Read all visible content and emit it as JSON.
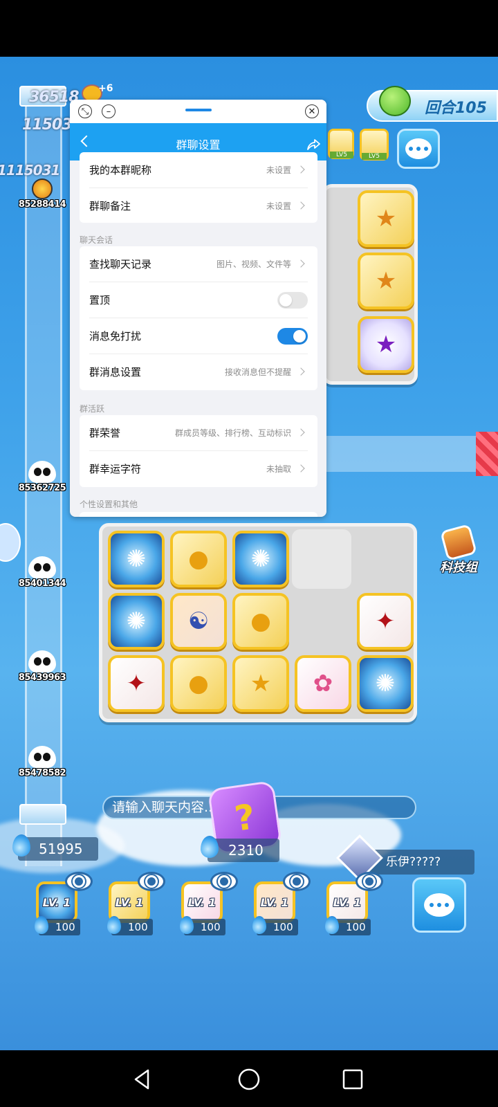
{
  "game": {
    "floating_numbers": [
      "36518",
      "11503",
      "1115031"
    ],
    "heart_bonus": "+6",
    "track_players": [
      {
        "id": "85288414"
      },
      {
        "id": "85362725"
      },
      {
        "id": "85401344"
      },
      {
        "id": "85439963"
      },
      {
        "id": "85478582"
      }
    ],
    "round_label": "回合105",
    "top_cards": [
      {
        "level": "LV5"
      },
      {
        "level": "LV5"
      }
    ],
    "tech_group_label": "科技组",
    "chat_placeholder": "请输入聊天内容...",
    "player_currency": "51995",
    "dice_cost": "2310",
    "opponent_name": "乐伊?????",
    "hand_cards": [
      {
        "level": "LV. 1",
        "cost": "100",
        "icon": "blue-orb-icon"
      },
      {
        "level": "LV. 1",
        "cost": "100",
        "icon": "gold-coin-icon"
      },
      {
        "level": "LV. 1",
        "cost": "100",
        "icon": "sakura-icon"
      },
      {
        "level": "LV. 1",
        "cost": "100",
        "icon": "human-figure-icon"
      },
      {
        "level": "LV. 1",
        "cost": "100",
        "icon": "red-claw-icon"
      }
    ]
  },
  "panel": {
    "title": "群聊设置",
    "rows_top": [
      {
        "label": "我的本群昵称",
        "value": "未设置"
      },
      {
        "label": "群聊备注",
        "value": "未设置"
      }
    ],
    "section_chat": "聊天会话",
    "rows_chat": [
      {
        "label": "查找聊天记录",
        "value": "图片、视频、文件等"
      },
      {
        "label": "置顶",
        "toggle": false
      },
      {
        "label": "消息免打扰",
        "toggle": true
      },
      {
        "label": "群消息设置",
        "value": "接收消息但不提醒"
      }
    ],
    "section_active": "群活跃",
    "rows_active": [
      {
        "label": "群荣誉",
        "value": "群成员等级、排行榜、互动标识"
      },
      {
        "label": "群幸运字符",
        "value": "未抽取"
      }
    ],
    "section_personal": "个性设置和其他"
  },
  "colors": {
    "accent": "#1da1f2",
    "toggle_on": "#1e88e5"
  }
}
